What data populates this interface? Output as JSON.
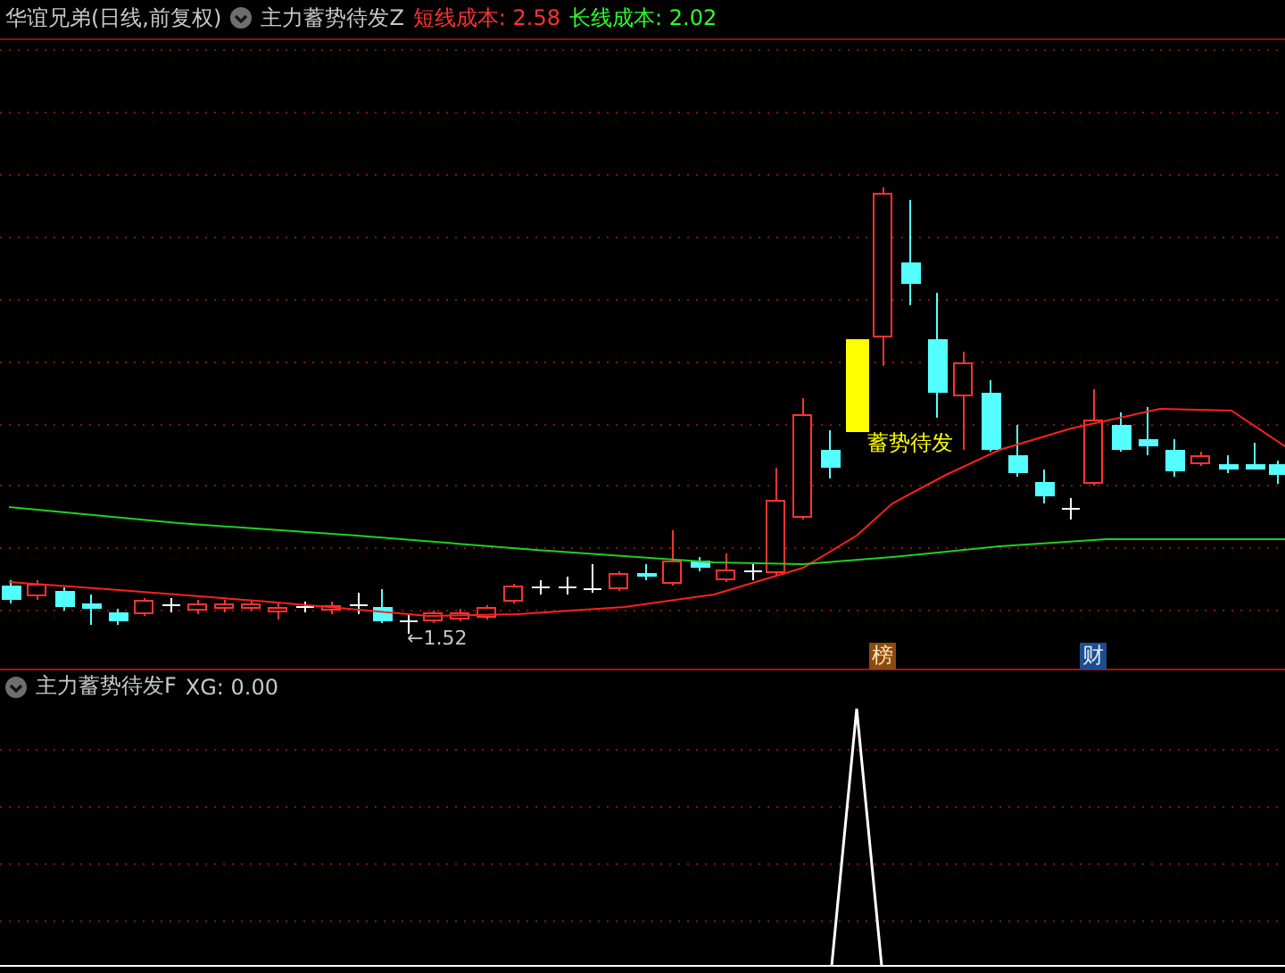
{
  "header": {
    "stock_name": "华谊兄弟(日线,前复权)",
    "indicator_name": "主力蓄势待发Z",
    "short_cost_label": "短线成本:",
    "short_cost_value": "2.58",
    "long_cost_label": "长线成本:",
    "long_cost_value": "2.02"
  },
  "main_chart": {
    "signal_label": "蓄势待发",
    "low_label": "←1.52",
    "badges": [
      {
        "text": "榜",
        "kind": "rank"
      },
      {
        "text": "财",
        "kind": "finance"
      }
    ]
  },
  "sub_panel": {
    "indicator_name": "主力蓄势待发F",
    "reading": "XG: 0.00"
  }
}
